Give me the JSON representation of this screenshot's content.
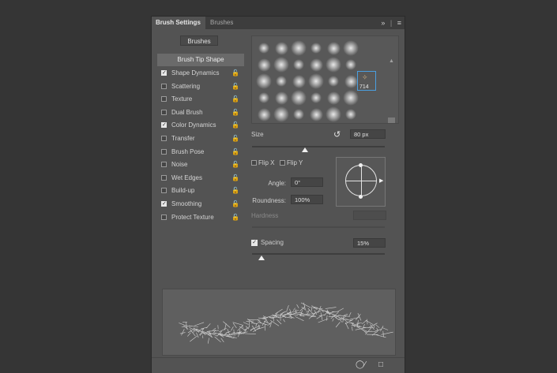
{
  "tabs": [
    {
      "label": "Brush Settings",
      "active": true
    },
    {
      "label": "Brushes",
      "active": false
    }
  ],
  "panel_menu_icons": [
    "double-chevron-right-icon",
    "panel-menu-icon"
  ],
  "brushes_button": "Brushes",
  "brush_tip_shape": "Brush Tip Shape",
  "options": [
    {
      "label": "Shape Dynamics",
      "checked": true
    },
    {
      "label": "Scattering",
      "checked": false
    },
    {
      "label": "Texture",
      "checked": false
    },
    {
      "label": "Dual Brush",
      "checked": false
    },
    {
      "label": "Color Dynamics",
      "checked": true
    },
    {
      "label": "Transfer",
      "checked": false
    },
    {
      "label": "Brush Pose",
      "checked": false
    },
    {
      "label": "Noise",
      "checked": false
    },
    {
      "label": "Wet Edges",
      "checked": false
    },
    {
      "label": "Build-up",
      "checked": false
    },
    {
      "label": "Smoothing",
      "checked": true
    },
    {
      "label": "Protect Texture",
      "checked": false
    }
  ],
  "preset_selected_number": "714",
  "size": {
    "label": "Size",
    "value": "80 px",
    "slider_fraction": 0.4
  },
  "flip_x": {
    "label": "Flip X",
    "checked": false
  },
  "flip_y": {
    "label": "Flip Y",
    "checked": false
  },
  "angle": {
    "label": "Angle:",
    "value": "0°"
  },
  "roundness": {
    "label": "Roundness:",
    "value": "100%"
  },
  "hardness": {
    "label": "Hardness",
    "value": ""
  },
  "spacing": {
    "label": "Spacing",
    "checked": true,
    "value": "15%",
    "slider_fraction": 0.07
  },
  "accent_color": "#4a9fe0"
}
